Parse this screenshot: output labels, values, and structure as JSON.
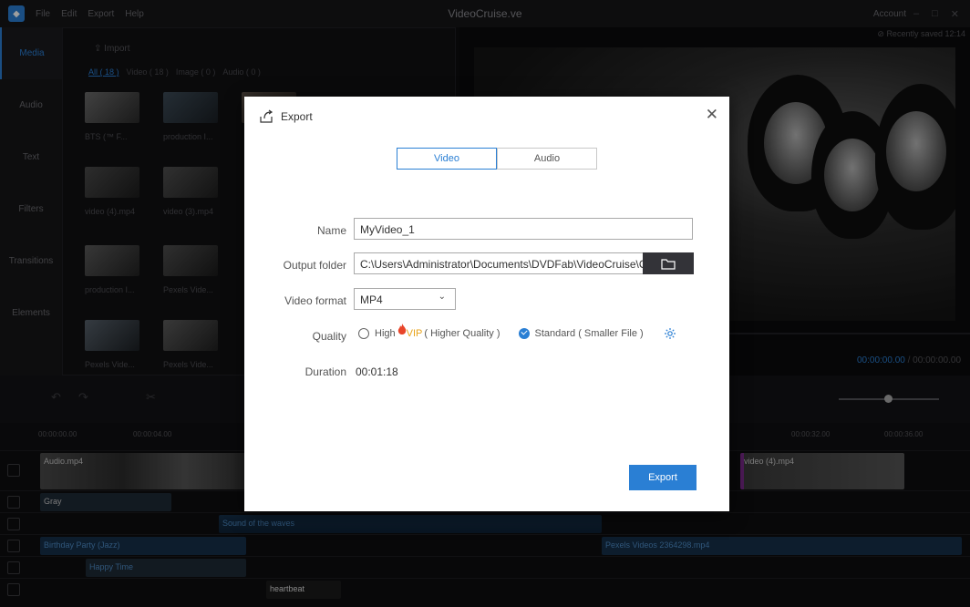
{
  "app": {
    "menu": [
      "File",
      "Edit",
      "Export",
      "Help"
    ],
    "title": "VideoCruise.ve",
    "account": "Account"
  },
  "sidebar": {
    "tabs": [
      "Media",
      "Audio",
      "Text",
      "Filters",
      "Transitions",
      "Elements"
    ]
  },
  "media": {
    "import_label": "Import",
    "filters": [
      "All ( 18 )",
      "Video ( 18 )",
      "Image ( 0 )",
      "Audio ( 0 )"
    ],
    "items": [
      "BTS (™ F...",
      "production I...",
      "video (4).mp4",
      "video (3).mp4",
      "production I...",
      "Pexels Vide...",
      "Pexels Vide...",
      "Pexels Vide..."
    ]
  },
  "preview": {
    "saved": "Recently saved 12:14",
    "time_current": "00:00:00.00",
    "time_total": "00:00:00.00"
  },
  "timeline": {
    "ruler": [
      "00:00:00.00",
      "00:00:04.00",
      "00:00:32.00",
      "00:00:36.00"
    ],
    "clips": {
      "v1": "Audio.mp4",
      "v2": "video (4).mp4",
      "filter": "Gray",
      "sound": "Sound of the waves",
      "music": "Birthday Party (Jazz)",
      "pexels": "Pexels Videos 2364298.mp4",
      "text": "Happy Time",
      "sfx": "heartbeat"
    }
  },
  "dialog": {
    "title": "Export",
    "tabs": [
      "Video",
      "Audio"
    ],
    "name_label": "Name",
    "name_value": "MyVideo_1",
    "folder_label": "Output folder",
    "folder_value": "C:\\Users\\Administrator\\Documents\\DVDFab\\VideoCruise\\Output",
    "format_label": "Video format",
    "format_value": "MP4",
    "quality_label": "Quality",
    "quality_high": "High",
    "quality_vip": "VIP",
    "quality_high_note": "( Higher Quality )",
    "quality_standard": "Standard ( Smaller File )",
    "duration_label": "Duration",
    "duration_value": "00:01:18",
    "export_button": "Export"
  }
}
